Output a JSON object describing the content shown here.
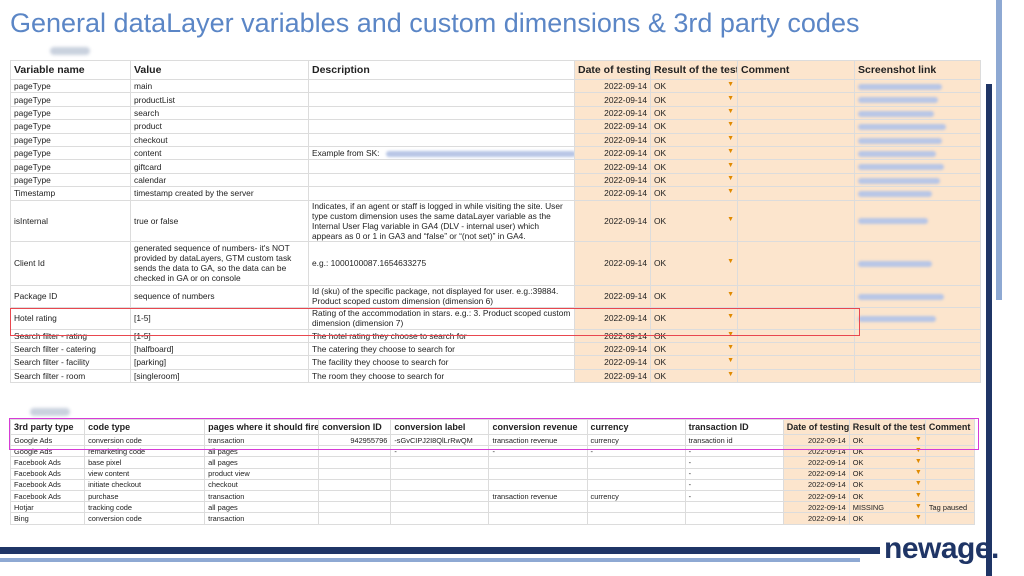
{
  "title": "General dataLayer variables and custom dimensions & 3rd party codes",
  "logo": "newage.",
  "table1": {
    "headers": [
      "Variable name",
      "Value",
      "Description",
      "Date of testing",
      "Result of the test",
      "Comment",
      "Screenshot link"
    ],
    "rows": [
      {
        "name": "pageType",
        "value": "main",
        "desc": "",
        "date": "2022-09-14",
        "result": "OK",
        "comment": ""
      },
      {
        "name": "pageType",
        "value": "productList",
        "desc": "",
        "date": "2022-09-14",
        "result": "OK",
        "comment": ""
      },
      {
        "name": "pageType",
        "value": "search",
        "desc": "",
        "date": "2022-09-14",
        "result": "OK",
        "comment": ""
      },
      {
        "name": "pageType",
        "value": "product",
        "desc": "",
        "date": "2022-09-14",
        "result": "OK",
        "comment": ""
      },
      {
        "name": "pageType",
        "value": "checkout",
        "desc": "",
        "date": "2022-09-14",
        "result": "OK",
        "comment": ""
      },
      {
        "name": "pageType",
        "value": "content",
        "desc": "Example from SK:",
        "date": "2022-09-14",
        "result": "OK",
        "comment": ""
      },
      {
        "name": "pageType",
        "value": "giftcard",
        "desc": "",
        "date": "2022-09-14",
        "result": "OK",
        "comment": ""
      },
      {
        "name": "pageType",
        "value": "calendar",
        "desc": "",
        "date": "2022-09-14",
        "result": "OK",
        "comment": ""
      },
      {
        "name": "Timestamp",
        "value": "timestamp created by the server",
        "desc": "",
        "date": "2022-09-14",
        "result": "OK",
        "comment": ""
      },
      {
        "name": "isInternal",
        "value": "true or false",
        "desc": "Indicates, if an agent or staff is logged in while visiting the site. User type custom dimension uses the same dataLayer variable as the Internal User Flag variable in GA4 (DLV - internal user) which appears as 0 or 1 in GA3 and “false” or “(not set)” in GA4.",
        "date": "2022-09-14",
        "result": "OK",
        "comment": ""
      },
      {
        "name": "Client Id",
        "value": "generated sequence of numbers- it's NOT provided by dataLayers, GTM custom task sends the data to GA, so the data can be checked in GA or on console",
        "desc": "e.g.: 1000100087.1654633275",
        "date": "2022-09-14",
        "result": "OK",
        "comment": ""
      },
      {
        "name": "Package ID",
        "value": "sequence of numbers",
        "desc": "Id (sku) of the specific package, not displayed for user. e.g.:39884. Product scoped custom dimension (dimension 6)",
        "date": "2022-09-14",
        "result": "OK",
        "comment": ""
      },
      {
        "name": "Hotel rating",
        "value": "[1-5]",
        "desc": "Rating of the accommodation in stars. e.g.: 3. Product scoped custom dimension (dimension 7)",
        "date": "2022-09-14",
        "result": "OK",
        "comment": ""
      },
      {
        "name": "Search filter - rating",
        "value": "[1-5]",
        "desc": "The hotel rating they choose to search for",
        "date": "2022-09-14",
        "result": "OK",
        "comment": ""
      },
      {
        "name": "Search filter - catering",
        "value": "[halfboard]",
        "desc": "The catering they choose to search for",
        "date": "2022-09-14",
        "result": "OK",
        "comment": ""
      },
      {
        "name": "Search filter - facility",
        "value": "[parking]",
        "desc": "The facility they choose to search for",
        "date": "2022-09-14",
        "result": "OK",
        "comment": ""
      },
      {
        "name": "Search filter - room",
        "value": "[singleroom]",
        "desc": "The room they choose to search for",
        "date": "2022-09-14",
        "result": "OK",
        "comment": ""
      }
    ]
  },
  "table2": {
    "headers": [
      "3rd party type",
      "code type",
      "pages where it should fire",
      "conversion ID",
      "conversion label",
      "conversion revenue",
      "currency",
      "transaction ID",
      "Date of testing",
      "Result of the test",
      "Comment"
    ],
    "rows": [
      {
        "type": "Google Ads",
        "code": "conversion code",
        "pages": "transaction",
        "conv_id": "942955796",
        "label": "-sGvCIPJ2I8QlLrRwQM",
        "revenue": "transaction revenue",
        "currency": "currency",
        "txn": "transaction id",
        "date": "2022-09-14",
        "result": "OK",
        "comment": ""
      },
      {
        "type": "Google Ads",
        "code": "remarketing code",
        "pages": "all pages",
        "conv_id": "",
        "label": "-",
        "revenue": "-",
        "currency": "-",
        "txn": "-",
        "date": "2022-09-14",
        "result": "OK",
        "comment": ""
      },
      {
        "type": "Facebook Ads",
        "code": "base pixel",
        "pages": "all pages",
        "conv_id": "",
        "label": "",
        "revenue": "",
        "currency": "",
        "txn": "-",
        "date": "2022-09-14",
        "result": "OK",
        "comment": ""
      },
      {
        "type": "Facebook Ads",
        "code": "view content",
        "pages": "product view",
        "conv_id": "",
        "label": "",
        "revenue": "",
        "currency": "",
        "txn": "-",
        "date": "2022-09-14",
        "result": "OK",
        "comment": ""
      },
      {
        "type": "Facebook Ads",
        "code": "initiate checkout",
        "pages": "checkout",
        "conv_id": "",
        "label": "",
        "revenue": "",
        "currency": "",
        "txn": "-",
        "date": "2022-09-14",
        "result": "OK",
        "comment": ""
      },
      {
        "type": "Facebook Ads",
        "code": "purchase",
        "pages": "transaction",
        "conv_id": "",
        "label": "",
        "revenue": "transaction revenue",
        "currency": "currency",
        "txn": "-",
        "date": "2022-09-14",
        "result": "OK",
        "comment": ""
      },
      {
        "type": "Hotjar",
        "code": "tracking code",
        "pages": "all pages",
        "conv_id": "",
        "label": "",
        "revenue": "",
        "currency": "",
        "txn": "",
        "date": "2022-09-14",
        "result": "MISSING",
        "comment": "Tag paused"
      },
      {
        "type": "Bing",
        "code": "conversion code",
        "pages": "transaction",
        "conv_id": "",
        "label": "",
        "revenue": "",
        "currency": "",
        "txn": "",
        "date": "2022-09-14",
        "result": "OK",
        "comment": ""
      }
    ]
  }
}
